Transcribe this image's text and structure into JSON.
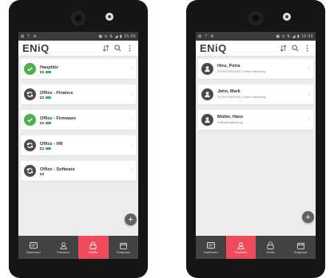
{
  "colors": {
    "accent": "#ef4b5c",
    "ok": "#4caf50",
    "nav_bg": "#424242"
  },
  "phones": {
    "left": {
      "status": {
        "left": "⊠ ⊤ ⚙",
        "right": "▣ ⊙ ⇅ ◢ ▮ 15:39"
      },
      "app": {
        "logo": "ENiQ"
      },
      "items": [
        {
          "title": "Haupttür",
          "sub_icon": "door-icon",
          "avatar": "check-icon",
          "avatar_color": "#4caf50"
        },
        {
          "title": "Office - Finance",
          "sub_icon": "door-icon",
          "avatar": "check-icon",
          "avatar_color": "#4caf50"
        },
        {
          "title": "Office - Firmware",
          "sub_icon": "door-icon",
          "avatar": "check-icon",
          "avatar_color": "#4caf50"
        },
        {
          "title": "Office - HR",
          "sub_icon": "door-icon",
          "avatar": "sync-icon",
          "avatar_color": "#4a4a4a"
        },
        {
          "title": "Office - Software",
          "sub_icon": "door-icon",
          "avatar": "sync-icon",
          "avatar_color": "#4a4a4a"
        }
      ],
      "nav": [
        {
          "label": "Dashboard",
          "icon": "dashboard-icon",
          "active": false
        },
        {
          "label": "Personen",
          "icon": "person-icon",
          "active": false
        },
        {
          "label": "Geräte",
          "icon": "lock-icon",
          "active": true
        },
        {
          "label": "Ereignisse",
          "icon": "calendar-icon",
          "active": false
        }
      ],
      "fab": "+"
    },
    "right": {
      "status": {
        "left": "⊠ ⊤ ⚙",
        "right": "▣ ⊙ ⇅ ◢ ▮ 16:39"
      },
      "app": {
        "logo": "ENiQ"
      },
      "items": [
        {
          "title": "Hinz, Petra",
          "sub": "0145076530040 | Keine Abteilung",
          "avatar": "person-icon"
        },
        {
          "title": "Jahn, Mark",
          "sub": "0145076504000 | Keine Abteilung",
          "avatar": "person-icon"
        },
        {
          "title": "Müller, Hans",
          "sub": "Softwareabteilung",
          "avatar": "person-icon"
        }
      ],
      "nav": [
        {
          "label": "Dashboard",
          "icon": "dashboard-icon",
          "active": false
        },
        {
          "label": "Personen",
          "icon": "person-icon",
          "active": true
        },
        {
          "label": "Geräte",
          "icon": "lock-icon",
          "active": false
        },
        {
          "label": "Ereignisse",
          "icon": "calendar-icon",
          "active": false
        }
      ],
      "fab": "+"
    }
  }
}
